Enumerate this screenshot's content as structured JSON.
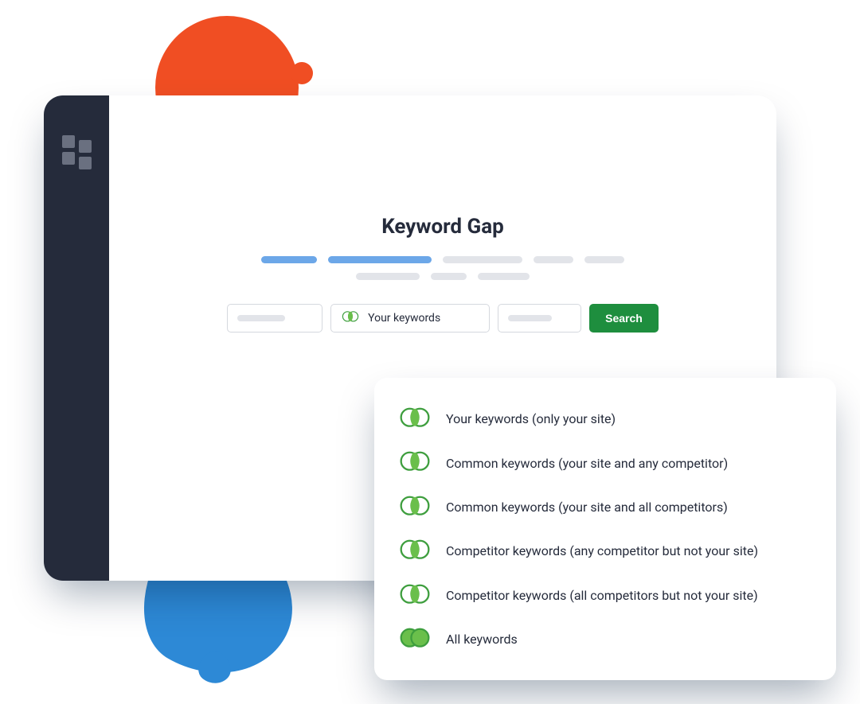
{
  "title": "Keyword Gap",
  "search_button": "Search",
  "keyword_selector_label": "Your keywords",
  "dropdown": [
    {
      "label": "Your keywords (only your site)"
    },
    {
      "label": "Common keywords (your site and any competitor)"
    },
    {
      "label": "Common keywords (your site and all competitors)"
    },
    {
      "label": "Competitor keywords (any competitor but not your site)"
    },
    {
      "label": "Competitor keywords (all competitors but not your site)"
    },
    {
      "label": "All keywords"
    }
  ]
}
